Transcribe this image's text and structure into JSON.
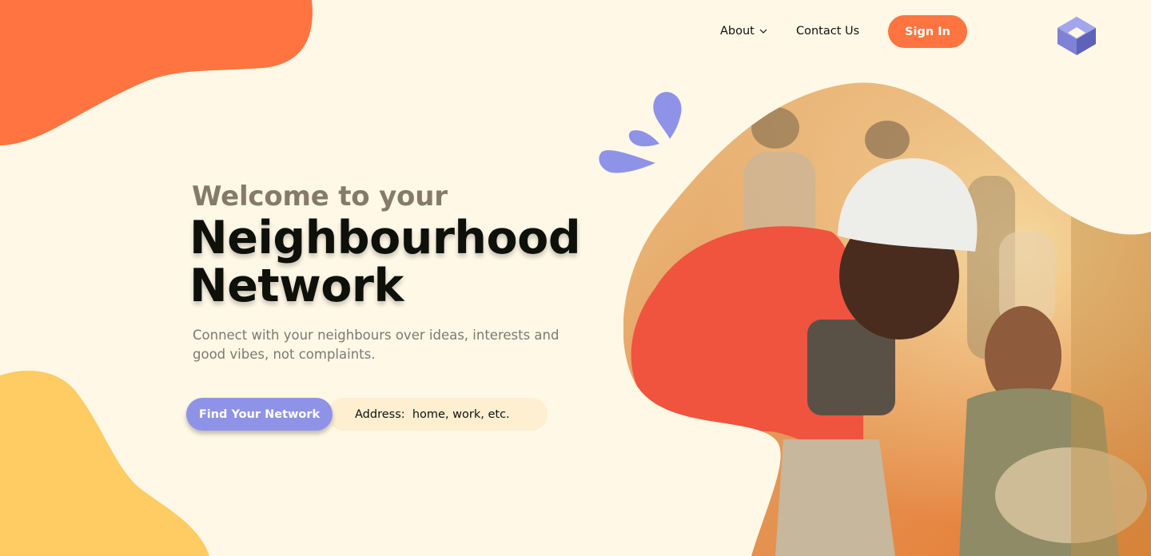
{
  "nav": {
    "about_label": "About",
    "contact_label": "Contact Us",
    "signin_label": "Sign In"
  },
  "hero": {
    "welcome": "Welcome to your",
    "title_line1": "Neighbourhood",
    "title_line2": "Network",
    "subtitle": "Connect with your neighbours over ideas, interests and good vibes, not complaints."
  },
  "search": {
    "button_label": "Find Your Network",
    "address_placeholder": "Address:  home, work, etc."
  },
  "icons": {
    "logo": "cube-logo-icon",
    "about_chevron": "chevron-down-icon",
    "splash": "splash-drops-icon"
  },
  "colors": {
    "background": "#FFF8E6",
    "accent_orange": "#FF7440",
    "accent_yellow": "#FFCB63",
    "accent_purple": "#8E93E8",
    "input_bg": "#FDEFCF"
  }
}
